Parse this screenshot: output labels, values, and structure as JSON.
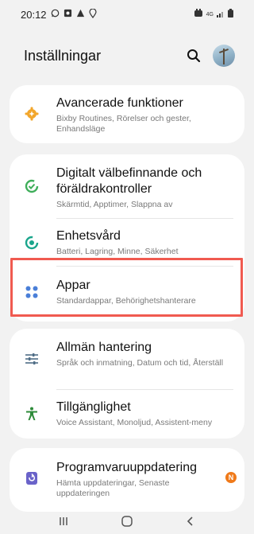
{
  "status_bar": {
    "time": "20:12",
    "network": "4G"
  },
  "header": {
    "title": "Inställningar"
  },
  "items": {
    "advanced": {
      "title": "Avancerade funktioner",
      "subtitle": "Bixby Routines, Rörelser och gester, Enhandsläge",
      "icon": "gear-icon",
      "color": "#f2a62b"
    },
    "wellbeing": {
      "title": "Digitalt välbefinnande och föräldrakontroller",
      "subtitle": "Skärmtid, Apptimer, Slappna av",
      "icon": "wellbeing-icon",
      "color": "#3fae5a"
    },
    "care": {
      "title": "Enhetsvård",
      "subtitle": "Batteri, Lagring, Minne, Säkerhet",
      "icon": "device-care-icon",
      "color": "#1aa58c"
    },
    "apps": {
      "title": "Appar",
      "subtitle": "Standardappar, Behörighetshanterare",
      "icon": "apps-icon",
      "color": "#4a7fd8"
    },
    "general": {
      "title": "Allmän hantering",
      "subtitle": "Språk och inmatning, Datum och tid, Återställ",
      "icon": "sliders-icon",
      "color": "#4f6d86"
    },
    "accessibility": {
      "title": "Tillgänglighet",
      "subtitle": "Voice Assistant, Monoljud, Assistent-meny",
      "icon": "accessibility-icon",
      "color": "#2e8b3a"
    },
    "update": {
      "title": "Programvaruuppdatering",
      "subtitle": "Hämta uppdateringar, Senaste uppdateringen",
      "icon": "update-icon",
      "color": "#6a63c9",
      "badge": "N"
    }
  }
}
